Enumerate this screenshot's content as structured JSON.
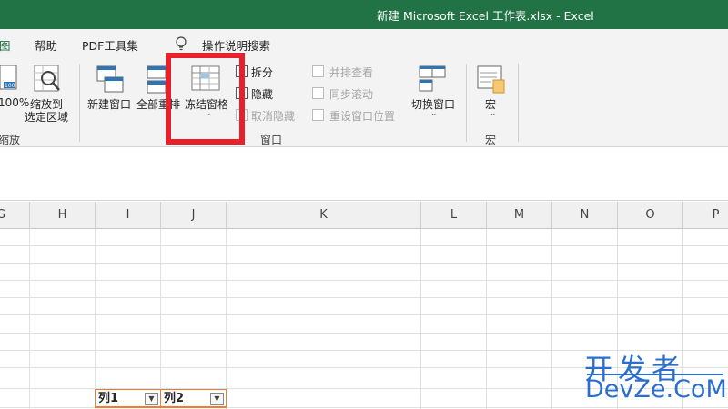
{
  "titlebar": {
    "title": "新建 Microsoft Excel 工作表.xlsx  -  Excel"
  },
  "menu": {
    "tabs": [
      "图",
      "帮助",
      "PDF工具集"
    ],
    "tell_me": "操作说明搜索"
  },
  "ribbon": {
    "zoom": {
      "pct": "100%",
      "zoom_to_sel_1": "缩放到",
      "zoom_to_sel_2": "选定区域",
      "group": "缩放"
    },
    "window": {
      "new_window": "新建窗口",
      "arrange_all": "全部重排",
      "freeze_panes": "冻结窗格",
      "split": "拆分",
      "hide": "隐藏",
      "unhide": "取消隐藏",
      "side_by_side": "并排查看",
      "sync_scroll": "同步滚动",
      "reset_pos": "重设窗口位置",
      "switch_windows": "切换窗口",
      "group": "窗口"
    },
    "macros": {
      "macro": "宏",
      "group": "宏"
    }
  },
  "sheet": {
    "columns": [
      "G",
      "H",
      "I",
      "J",
      "K",
      "L",
      "M",
      "N",
      "O",
      "P"
    ],
    "headers": [
      "列1",
      "列2"
    ]
  },
  "watermark": {
    "line1": "开发者",
    "line2": "DevZe.CoM"
  },
  "colors": {
    "accent": "#217346",
    "highlight": "#e8202a",
    "table_border": "#ed7d31",
    "watermark": "#2a6fd0"
  }
}
